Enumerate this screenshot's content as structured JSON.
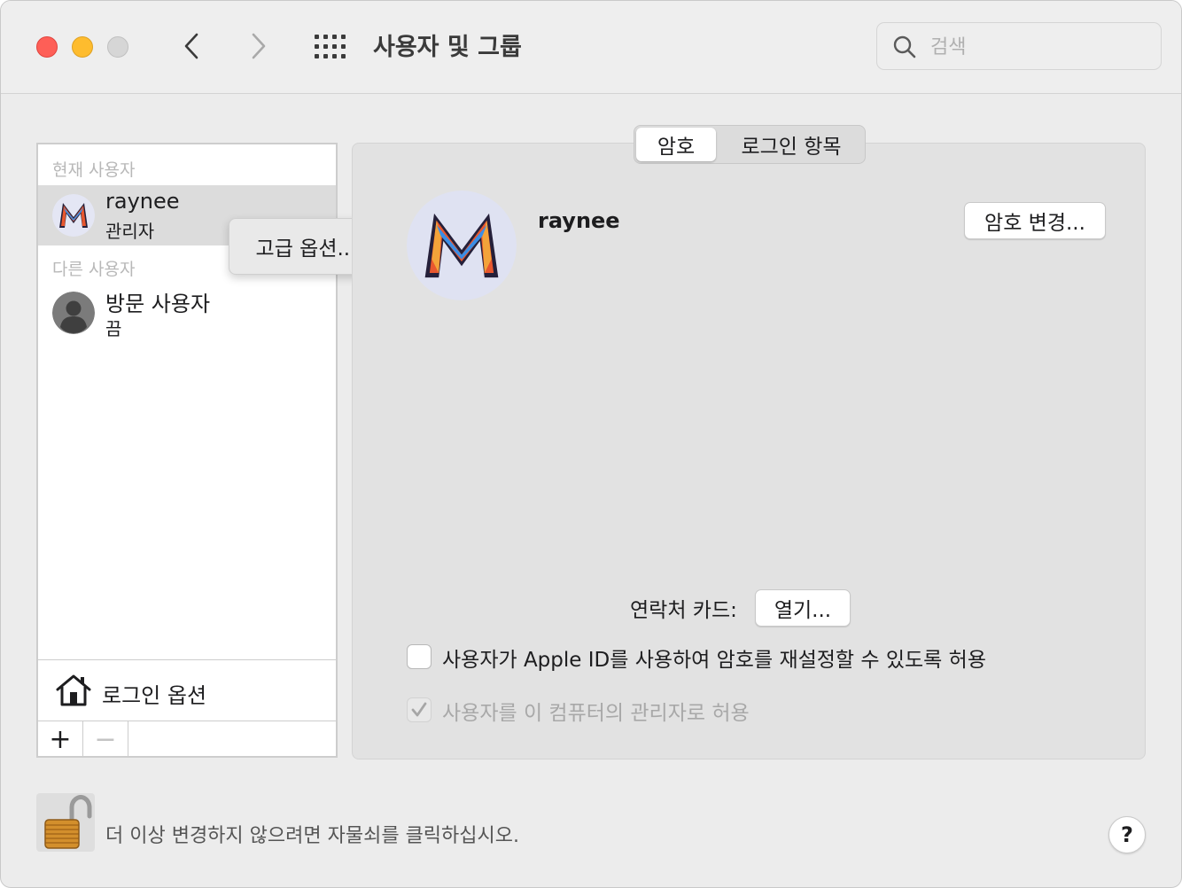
{
  "window": {
    "title": "사용자 및 그룹",
    "search_placeholder": "검색"
  },
  "sidebar": {
    "current_users_label": "현재 사용자",
    "other_users_label": "다른 사용자",
    "current_user": {
      "name": "raynee",
      "role": "관리자"
    },
    "other_user": {
      "name": "방문 사용자",
      "status": "끔"
    },
    "login_options_label": "로그인 옵션",
    "add_label": "+",
    "remove_label": "−"
  },
  "context_menu": {
    "item": "고급 옵션..."
  },
  "tabs": [
    {
      "label": "암호"
    },
    {
      "label": "로그인 항목"
    }
  ],
  "detail": {
    "username": "raynee",
    "change_password_label": "암호 변경...",
    "contact_card_label": "연락처 카드:",
    "open_label": "열기...",
    "allow_apple_id_label": "사용자가 Apple ID를 사용하여 암호를 재설정할 수 있도록 허용",
    "allow_apple_id_checked": false,
    "allow_admin_label": "사용자를 이 컴퓨터의 관리자로 허용",
    "allow_admin_checked": true
  },
  "footer": {
    "lock_text": "더 이상 변경하지 않으려면 자물쇠를 클릭하십시오.",
    "help_label": "?"
  },
  "icons": {
    "back": "chevron-left-icon",
    "forward": "chevron-right-icon",
    "show_all": "grid-icon",
    "search": "magnifier-icon",
    "login_options": "house-icon",
    "lock": "padlock-open-icon"
  },
  "colors": {
    "close": "#fe5f57",
    "minimize": "#febc2e",
    "zoom_inactive": "#d6d6d6",
    "selection": "#dcdcdc"
  }
}
